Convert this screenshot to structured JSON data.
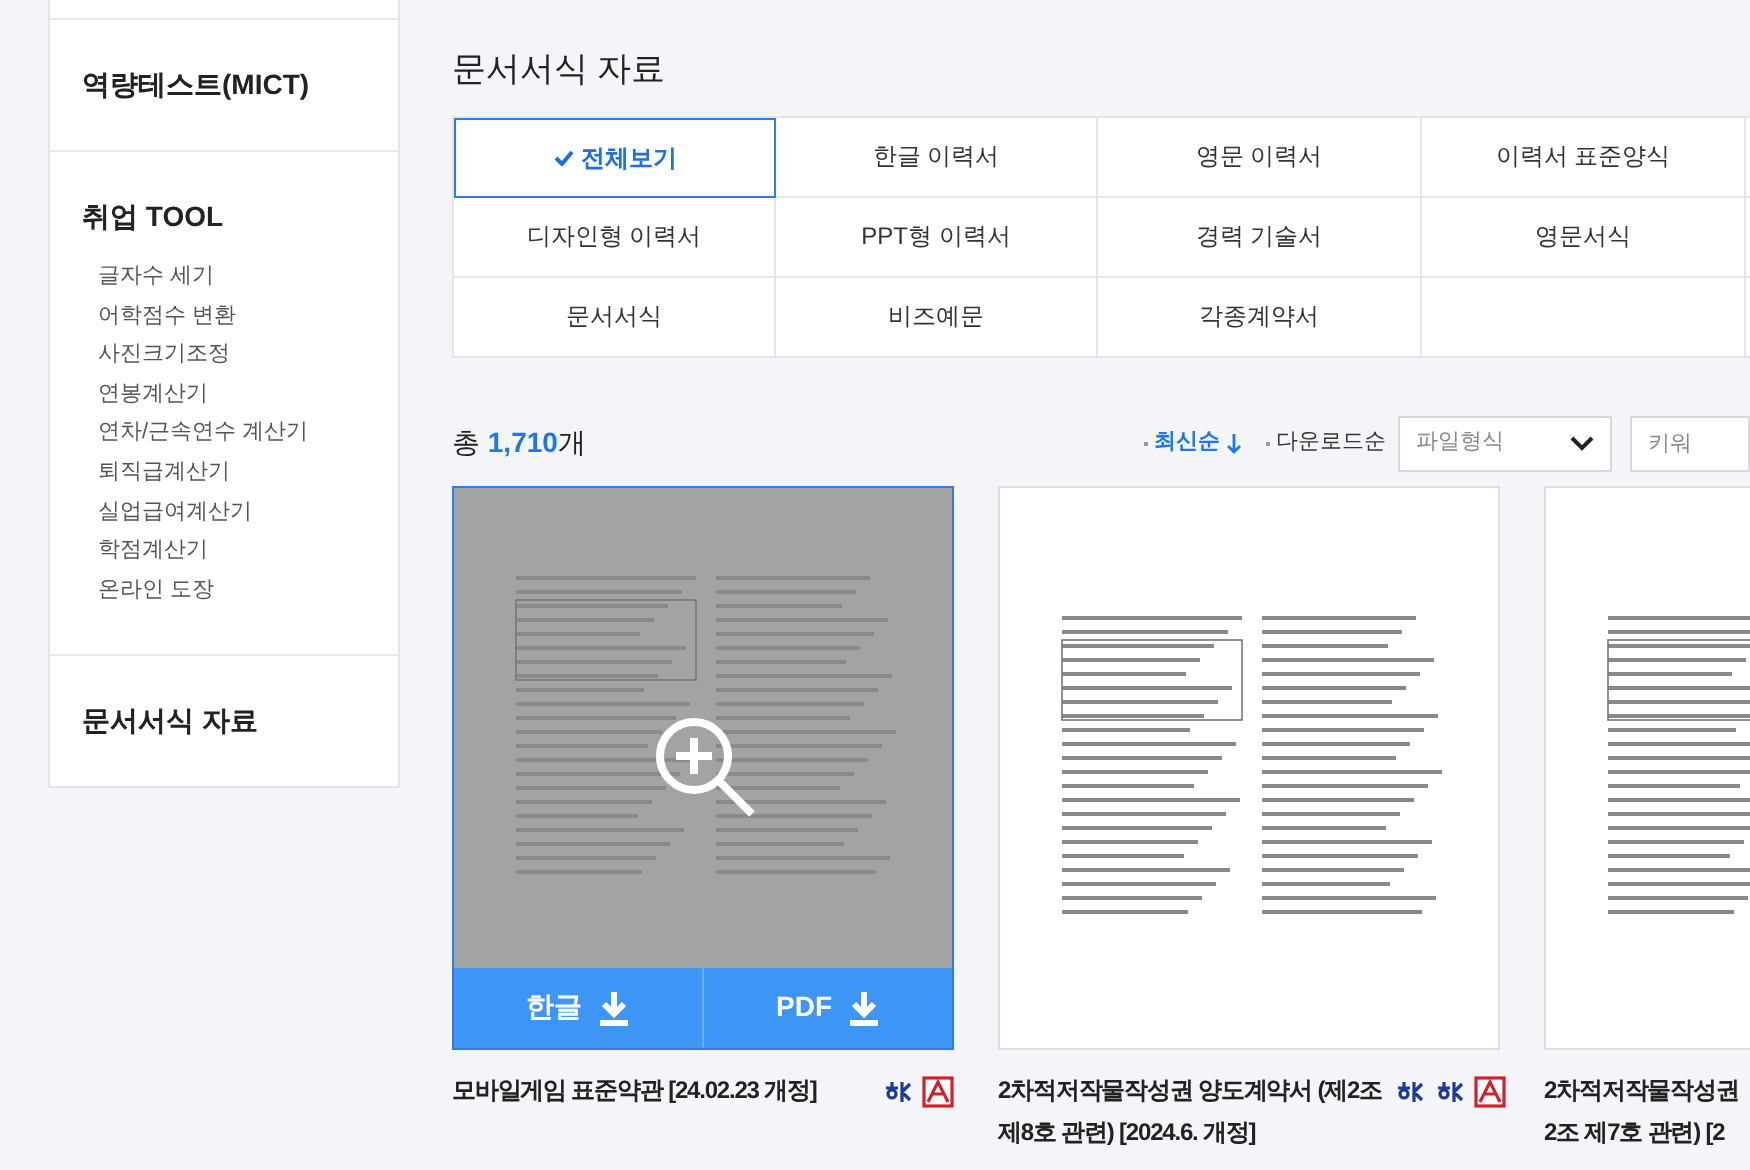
{
  "sidebar": {
    "sections": [
      {
        "title": "역량테스트(MICT)"
      },
      {
        "title": "취업 TOOL",
        "items": [
          "글자수 세기",
          "어학점수 변환",
          "사진크기조정",
          "연봉계산기",
          "연차/근속연수 계산기",
          "퇴직급계산기",
          "실업급여계산기",
          "학점계산기",
          "온라인 도장"
        ]
      },
      {
        "title": "문서서식 자료"
      }
    ]
  },
  "page_title": "문서서식 자료",
  "categories": [
    {
      "label": "전체보기",
      "selected": true
    },
    {
      "label": "한글 이력서",
      "selected": false
    },
    {
      "label": "영문 이력서",
      "selected": false
    },
    {
      "label": "이력서 표준양식",
      "selected": false
    },
    {
      "label": "디자인형 이력서",
      "selected": false
    },
    {
      "label": "PPT형 이력서",
      "selected": false
    },
    {
      "label": "경력 기술서",
      "selected": false
    },
    {
      "label": "영문서식",
      "selected": false
    },
    {
      "label": "문서서식",
      "selected": false
    },
    {
      "label": "비즈예문",
      "selected": false
    },
    {
      "label": "각종계약서",
      "selected": false
    }
  ],
  "total": {
    "prefix": "총",
    "count": "1,710",
    "suffix": "개"
  },
  "sort_options": [
    {
      "label": "최신순",
      "selected": true
    },
    {
      "label": "다운로드순",
      "selected": false
    }
  ],
  "file_type_select": {
    "value": "파일형식"
  },
  "keyword_field": {
    "placeholder": "키워"
  },
  "cards": [
    {
      "title_lines": [
        "모바일게임 표준약관 [24.02.23 개정]"
      ],
      "hovered": true,
      "buttons": [
        "한글",
        "PDF"
      ],
      "formats": [
        {
          "kind": "hwp"
        },
        {
          "kind": "pdf"
        }
      ]
    },
    {
      "title_lines": [
        "2차적저작물작성권 양도계약서 (제2조",
        "제8호 관련) [2024.6. 개정]"
      ],
      "hovered": false,
      "formats": [
        {
          "kind": "hwp"
        },
        {
          "kind": "hwp"
        },
        {
          "kind": "pdf"
        }
      ]
    },
    {
      "title_lines": [
        "2차적저작물작성권",
        "2조 제7호 관련) [2"
      ],
      "hovered": false
    }
  ]
}
